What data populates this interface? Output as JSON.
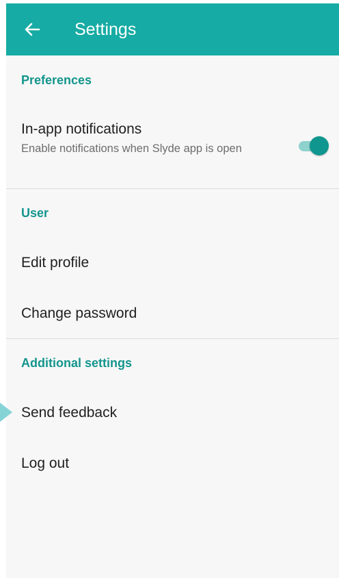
{
  "appbar": {
    "title": "Settings",
    "back_icon": "arrow-left-icon",
    "color": "#16aba4"
  },
  "sections": {
    "preferences": {
      "header": "Preferences",
      "in_app_notifications": {
        "title": "In-app notifications",
        "subtitle": "Enable notifications when Slyde app is open",
        "enabled": true
      }
    },
    "user": {
      "header": "User",
      "edit_profile": "Edit profile",
      "change_password": "Change password"
    },
    "additional": {
      "header": "Additional settings",
      "send_feedback": "Send feedback",
      "log_out": "Log out"
    }
  },
  "colors": {
    "accent": "#13958d",
    "toggle_thumb": "#0f968e",
    "toggle_track": "#8fd2cd",
    "background": "#f7f7f7"
  }
}
